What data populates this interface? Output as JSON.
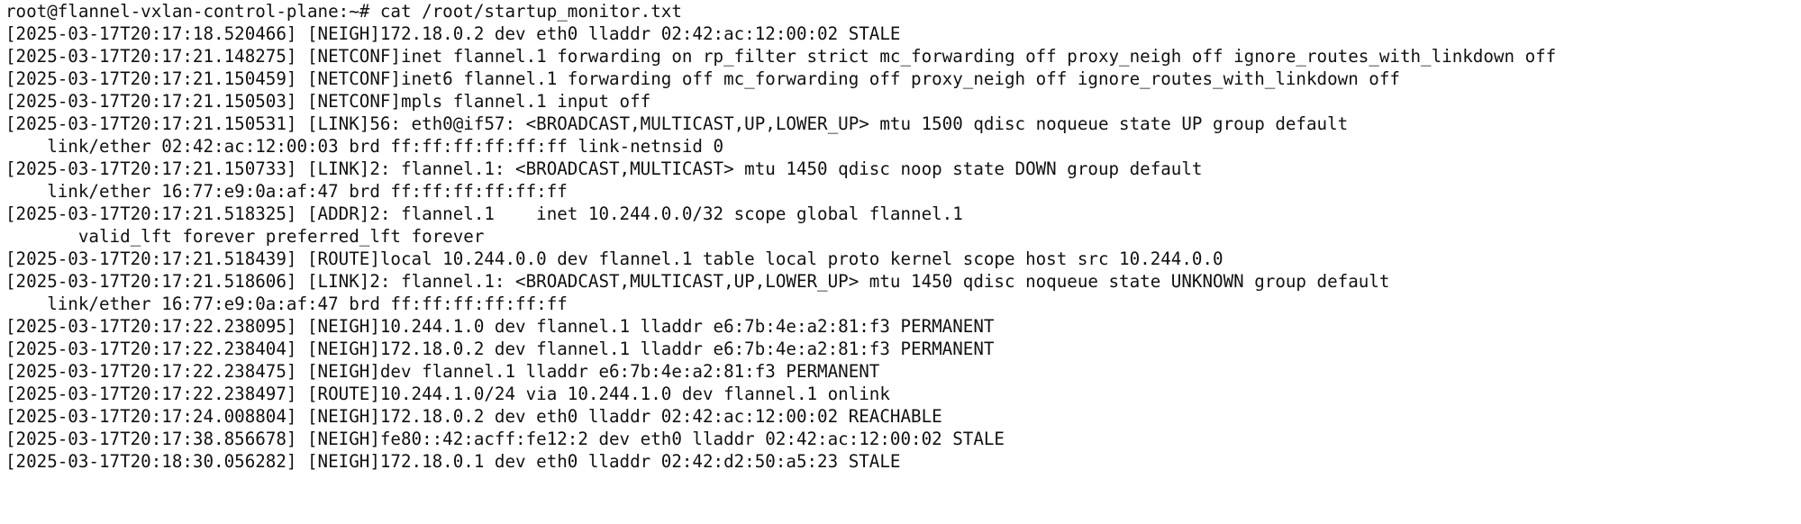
{
  "terminal": {
    "lines": [
      "root@flannel-vxlan-control-plane:~# cat /root/startup_monitor.txt",
      "[2025-03-17T20:17:18.520466] [NEIGH]172.18.0.2 dev eth0 lladdr 02:42:ac:12:00:02 STALE",
      "[2025-03-17T20:17:21.148275] [NETCONF]inet flannel.1 forwarding on rp_filter strict mc_forwarding off proxy_neigh off ignore_routes_with_linkdown off",
      "[2025-03-17T20:17:21.150459] [NETCONF]inet6 flannel.1 forwarding off mc_forwarding off proxy_neigh off ignore_routes_with_linkdown off",
      "[2025-03-17T20:17:21.150503] [NETCONF]mpls flannel.1 input off",
      "[2025-03-17T20:17:21.150531] [LINK]56: eth0@if57: <BROADCAST,MULTICAST,UP,LOWER_UP> mtu 1500 qdisc noqueue state UP group default",
      "    link/ether 02:42:ac:12:00:03 brd ff:ff:ff:ff:ff:ff link-netnsid 0",
      "[2025-03-17T20:17:21.150733] [LINK]2: flannel.1: <BROADCAST,MULTICAST> mtu 1450 qdisc noop state DOWN group default",
      "    link/ether 16:77:e9:0a:af:47 brd ff:ff:ff:ff:ff:ff",
      "[2025-03-17T20:17:21.518325] [ADDR]2: flannel.1    inet 10.244.0.0/32 scope global flannel.1",
      "       valid_lft forever preferred_lft forever",
      "[2025-03-17T20:17:21.518439] [ROUTE]local 10.244.0.0 dev flannel.1 table local proto kernel scope host src 10.244.0.0",
      "[2025-03-17T20:17:21.518606] [LINK]2: flannel.1: <BROADCAST,MULTICAST,UP,LOWER_UP> mtu 1450 qdisc noqueue state UNKNOWN group default",
      "    link/ether 16:77:e9:0a:af:47 brd ff:ff:ff:ff:ff:ff",
      "[2025-03-17T20:17:22.238095] [NEIGH]10.244.1.0 dev flannel.1 lladdr e6:7b:4e:a2:81:f3 PERMANENT",
      "[2025-03-17T20:17:22.238404] [NEIGH]172.18.0.2 dev flannel.1 lladdr e6:7b:4e:a2:81:f3 PERMANENT",
      "[2025-03-17T20:17:22.238475] [NEIGH]dev flannel.1 lladdr e6:7b:4e:a2:81:f3 PERMANENT",
      "[2025-03-17T20:17:22.238497] [ROUTE]10.244.1.0/24 via 10.244.1.0 dev flannel.1 onlink",
      "[2025-03-17T20:17:24.008804] [NEIGH]172.18.0.2 dev eth0 lladdr 02:42:ac:12:00:02 REACHABLE",
      "[2025-03-17T20:17:38.856678] [NEIGH]fe80::42:acff:fe12:2 dev eth0 lladdr 02:42:ac:12:00:02 STALE",
      "[2025-03-17T20:18:30.056282] [NEIGH]172.18.0.1 dev eth0 lladdr 02:42:d2:50:a5:23 STALE"
    ]
  }
}
